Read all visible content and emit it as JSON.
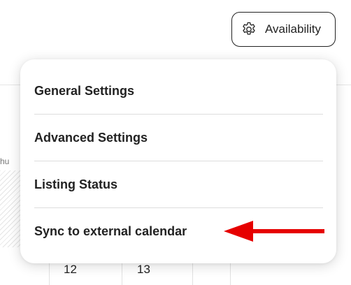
{
  "availability_button": {
    "label": "Availability",
    "icon": "gear-icon"
  },
  "background": {
    "partial_label": "hu",
    "dates": [
      "12",
      "13"
    ]
  },
  "menu": {
    "items": [
      {
        "label": "General Settings"
      },
      {
        "label": "Advanced Settings"
      },
      {
        "label": "Listing Status"
      },
      {
        "label": "Sync to external calendar"
      }
    ]
  },
  "annotation": {
    "arrow_color": "#e60000",
    "points_to": "Sync to external calendar"
  },
  "colors": {
    "text": "#222222",
    "divider": "#dddddd",
    "accent": "#e60000"
  }
}
